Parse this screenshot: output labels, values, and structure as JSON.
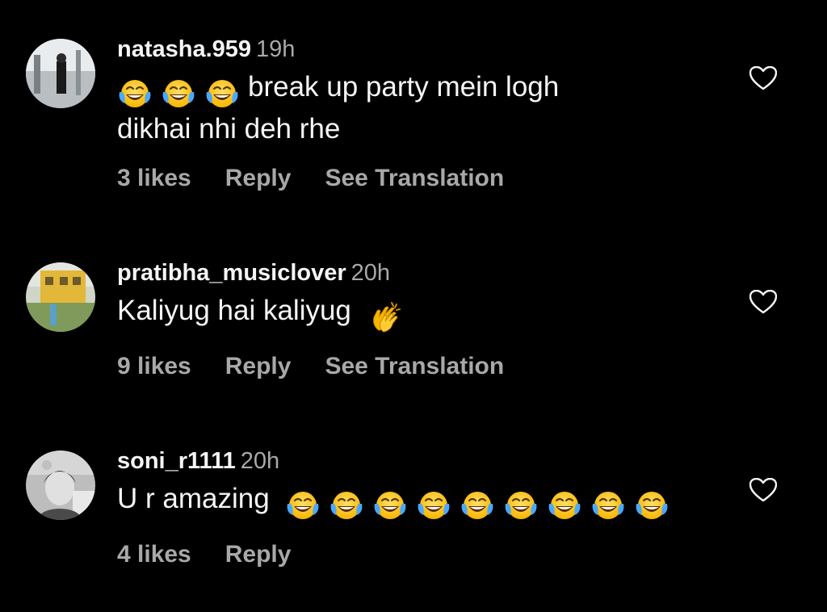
{
  "comments": [
    {
      "username": "natasha.959",
      "time": "19h",
      "text_line1": "break up party mein logh",
      "text_line2": "dikhai nhi deh rhe",
      "leading_emoji": [
        "face-with-tears-of-joy-emoji",
        "face-with-tears-of-joy-emoji",
        "face-with-tears-of-joy-emoji"
      ],
      "likes": "3 likes",
      "reply": "Reply",
      "translation": "See Translation",
      "avatar_icon": "avatar-natasha",
      "like_icon": "heart-outline-icon"
    },
    {
      "username": "pratibha_musiclover",
      "time": "20h",
      "text": "Kaliyug hai kaliyug",
      "trailing_emoji": [
        "clapping-hands-emoji"
      ],
      "likes": "9 likes",
      "reply": "Reply",
      "translation": "See Translation",
      "avatar_icon": "avatar-pratibha",
      "like_icon": "heart-outline-icon"
    },
    {
      "username": "soni_r1111",
      "time": "20h",
      "text": "U r amazing",
      "trailing_emoji": [
        "face-with-tears-of-joy-emoji",
        "face-with-tears-of-joy-emoji",
        "face-with-tears-of-joy-emoji",
        "face-with-tears-of-joy-emoji",
        "face-with-tears-of-joy-emoji",
        "face-with-tears-of-joy-emoji",
        "face-with-tears-of-joy-emoji",
        "face-with-tears-of-joy-emoji",
        "face-with-tears-of-joy-emoji"
      ],
      "likes": "4 likes",
      "reply": "Reply",
      "avatar_icon": "avatar-soni",
      "like_icon": "heart-outline-icon"
    }
  ],
  "colors": {
    "background": "#000000",
    "primary_text": "#f5f5f5",
    "secondary_text": "#a8a8a8",
    "emoji_yellow": "#ffcc33"
  }
}
